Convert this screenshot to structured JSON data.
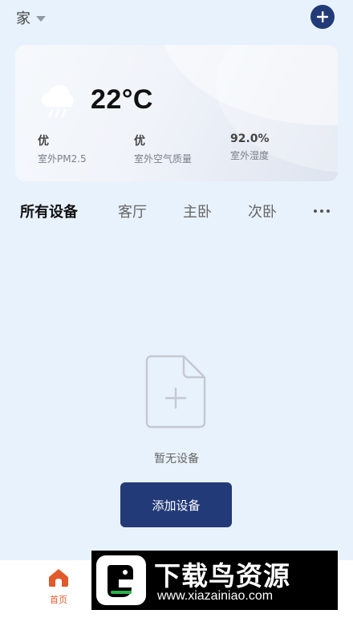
{
  "header": {
    "home_label": "家",
    "home_dropdown_icon": "caret-down-icon",
    "add_icon": "plus-icon",
    "accent_color": "#233a78"
  },
  "weather": {
    "icon": "rain-cloud-icon",
    "temperature": "22°C",
    "stats": [
      {
        "value": "优",
        "label": "室外PM2.5"
      },
      {
        "value": "优",
        "label": "室外空气质量"
      },
      {
        "value": "92.0%",
        "label": "室外湿度"
      }
    ]
  },
  "tabs": {
    "items": [
      {
        "label": "所有设备",
        "active": true
      },
      {
        "label": "客厅",
        "active": false
      },
      {
        "label": "主卧",
        "active": false
      },
      {
        "label": "次卧",
        "active": false
      }
    ],
    "more_icon": "more-dots-icon"
  },
  "empty_state": {
    "icon": "empty-file-plus-icon",
    "message": "暂无设备",
    "button_label": "添加设备"
  },
  "bottom_nav": {
    "items": [
      {
        "label": "首页",
        "icon": "home-icon",
        "active": true,
        "color": "#e05a2b"
      }
    ]
  },
  "watermark": {
    "title": "下载鸟资源",
    "url": "www.xiazainiao.com"
  }
}
